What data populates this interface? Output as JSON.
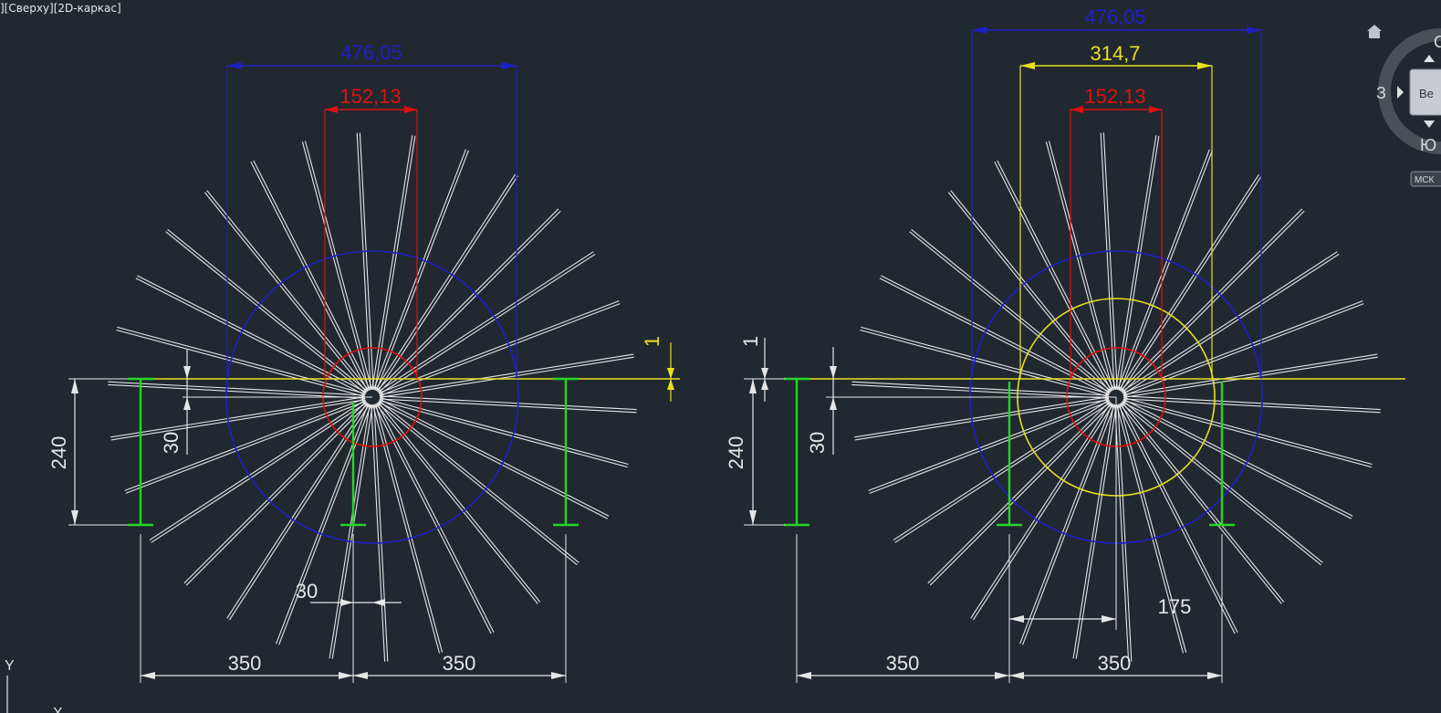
{
  "viewport_label": "][Сверху][2D-каркас]",
  "colors": {
    "background": "#212830",
    "white": "#e6e6e6",
    "blue": "#1c20c8",
    "red": "#e01010",
    "yellow": "#e8e020",
    "green": "#22d822"
  },
  "left_drawing": {
    "dim_blue": "476,05",
    "dim_red": "152,13",
    "dim_yellow_small": "1",
    "dim_height": "240",
    "dim_offset": "30",
    "dim_small_gap": "30",
    "dim_left_span": "350",
    "dim_right_span": "350"
  },
  "right_drawing": {
    "dim_blue": "476,05",
    "dim_yellow": "314,7",
    "dim_red": "152,13",
    "dim_small": "1",
    "dim_height": "240",
    "dim_offset": "30",
    "dim_half": "175",
    "dim_left_span": "350",
    "dim_right_span": "350"
  },
  "viewcube": {
    "compass_north": "С",
    "compass_west": "З",
    "compass_south": "Ю",
    "face_label": "Ве",
    "ucs_label": "МСК",
    "home_icon": "home-icon"
  },
  "ucs_axis": {
    "y_label": "Y",
    "x_label": "X"
  }
}
